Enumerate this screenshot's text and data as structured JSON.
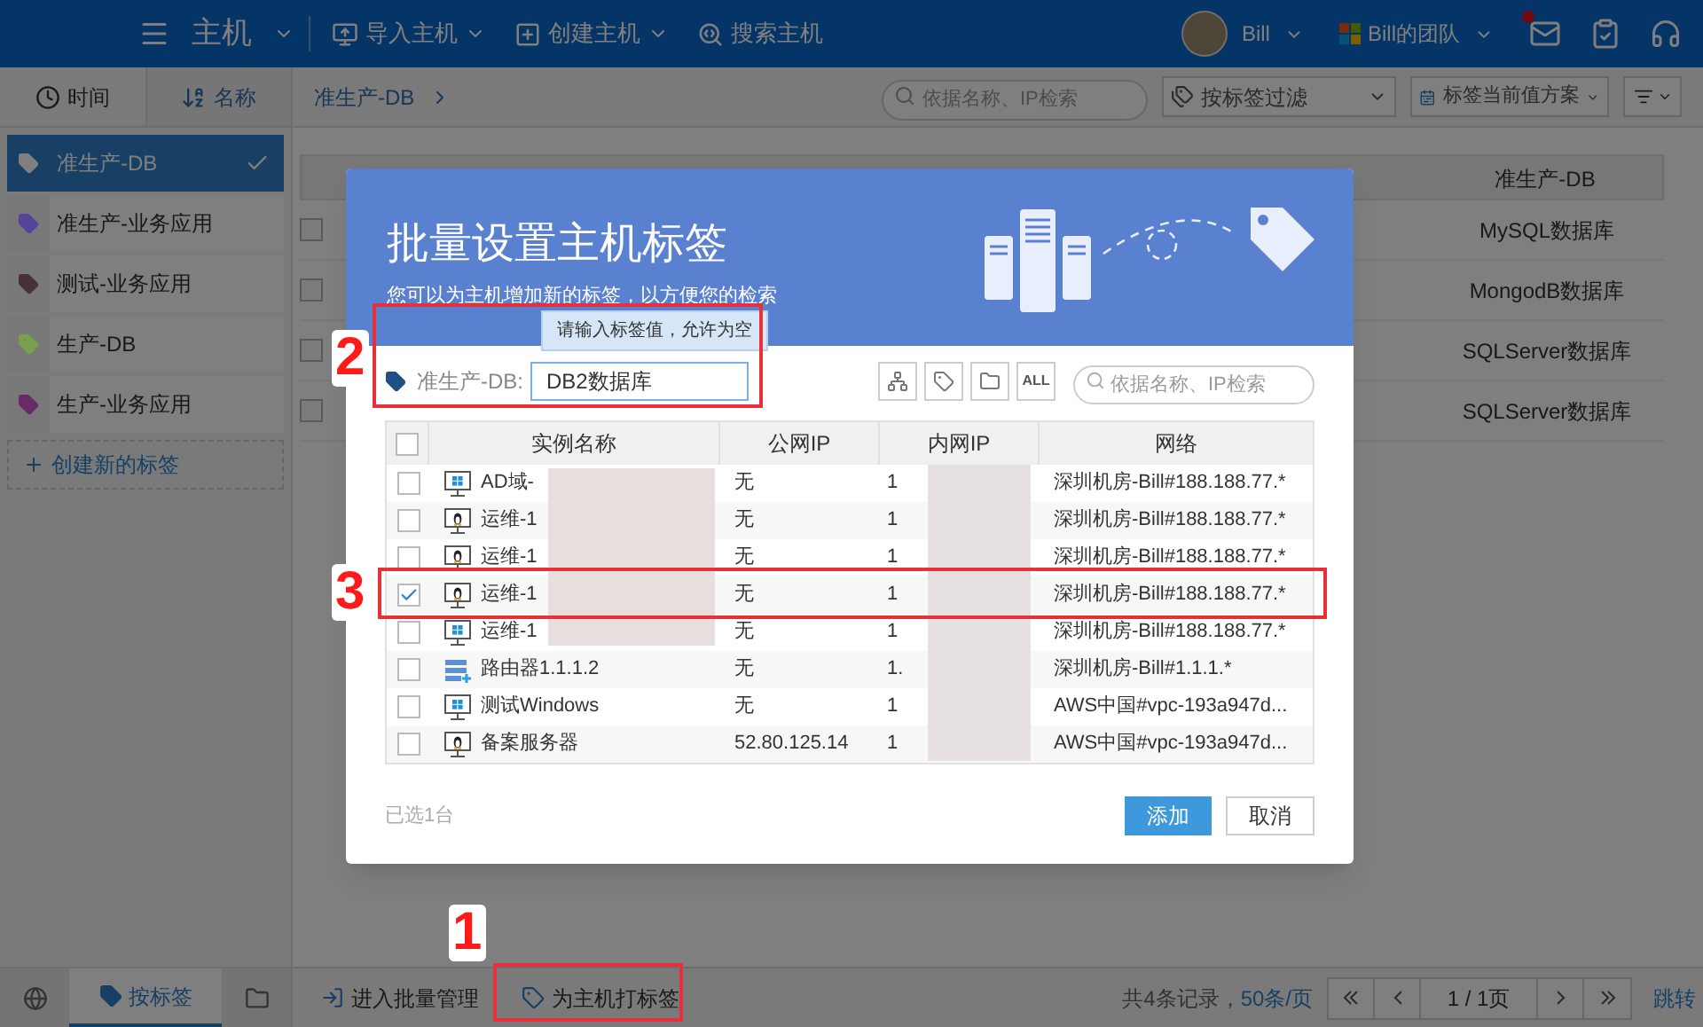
{
  "topbar": {
    "module": "主机",
    "actions": [
      "导入主机",
      "创建主机",
      "搜索主机"
    ],
    "user": "Bill",
    "team": "Bill的团队"
  },
  "sidebar": {
    "sort_tabs": [
      {
        "label": "时间",
        "selected": true
      },
      {
        "label": "名称",
        "selected": false
      }
    ],
    "tags": [
      {
        "label": "准生产-DB",
        "selected": true
      },
      {
        "label": "准生产-业务应用",
        "color": "#56449c",
        "selected": false
      },
      {
        "label": "测试-业务应用",
        "color": "#4a2f3c",
        "selected": false
      },
      {
        "label": "生产-DB",
        "color": "#78a04e",
        "selected": false
      },
      {
        "label": "生产-业务应用",
        "color": "#692a68",
        "selected": false
      }
    ],
    "create_label": "创建新的标签"
  },
  "breadcrumb": "准生产-DB",
  "search": {
    "placeholder": "依据名称、IP检索"
  },
  "tag_filter": "按标签过滤",
  "value_scheme": "标签当前值方案",
  "table": {
    "column": "准生产-DB",
    "rows": [
      {
        "checked": false,
        "value": "MySQL数据库"
      },
      {
        "checked": false,
        "value": "MongodB数据库"
      },
      {
        "checked": false,
        "value": "SQLServer数据库"
      },
      {
        "checked": false,
        "value": "SQLServer数据库"
      }
    ]
  },
  "dialog": {
    "title": "批量设置主机标签",
    "subtitle": "您可以为主机增加新的标签，以方便您的检索",
    "tooltip": "请输入标签值，允许为空",
    "tag_label": "准生产-DB:",
    "tag_value": "DB2数据库",
    "all_button": "ALL",
    "search_placeholder": "依据名称、IP检索",
    "columns": [
      "实例名称",
      "公网IP",
      "内网IP",
      "网络"
    ],
    "header_checked": false,
    "rows": [
      {
        "kind": "windows",
        "checked": false,
        "name": "AD域-",
        "public_ip": "无",
        "private_ip": "1",
        "network": "深圳机房-Bill#188.188.77.*"
      },
      {
        "kind": "linux",
        "checked": false,
        "name": "运维-1",
        "public_ip": "无",
        "private_ip": "1",
        "network": "深圳机房-Bill#188.188.77.*"
      },
      {
        "kind": "linux",
        "checked": false,
        "name": "运维-1",
        "public_ip": "无",
        "private_ip": "1",
        "network": "深圳机房-Bill#188.188.77.*"
      },
      {
        "kind": "linux",
        "checked": true,
        "name": "运维-1",
        "public_ip": "无",
        "private_ip": "1",
        "network": "深圳机房-Bill#188.188.77.*"
      },
      {
        "kind": "windows",
        "checked": false,
        "name": "运维-1",
        "public_ip": "无",
        "private_ip": "1",
        "network": "深圳机房-Bill#188.188.77.*"
      },
      {
        "kind": "router",
        "checked": false,
        "name": "路由器1.1.1.2",
        "public_ip": "无",
        "private_ip": "1.",
        "network": "深圳机房-Bill#1.1.1.*"
      },
      {
        "kind": "windows",
        "checked": false,
        "name": "测试Windows",
        "public_ip": "无",
        "private_ip": "1",
        "network": "AWS中国#vpc-193a947d..."
      },
      {
        "kind": "linux",
        "checked": false,
        "name": "备案服务器",
        "public_ip": "52.80.125.14",
        "private_ip": "1",
        "network": "AWS中国#vpc-193a947d..."
      }
    ],
    "selected_count": "已选1台",
    "confirm": "添加",
    "cancel": "取消"
  },
  "footer": {
    "view_tabs": [
      {
        "kind": "globe",
        "selected": false
      },
      {
        "kind": "tag",
        "label": "按标签",
        "selected": true
      },
      {
        "kind": "folder",
        "selected": false
      }
    ],
    "actions": [
      "进入批量管理",
      "为主机打标签"
    ],
    "records": "共4条记录，",
    "per_page": "50条/页",
    "page": "1 / 1页",
    "jump": "跳转"
  },
  "annotations": [
    "1",
    "2",
    "3"
  ]
}
